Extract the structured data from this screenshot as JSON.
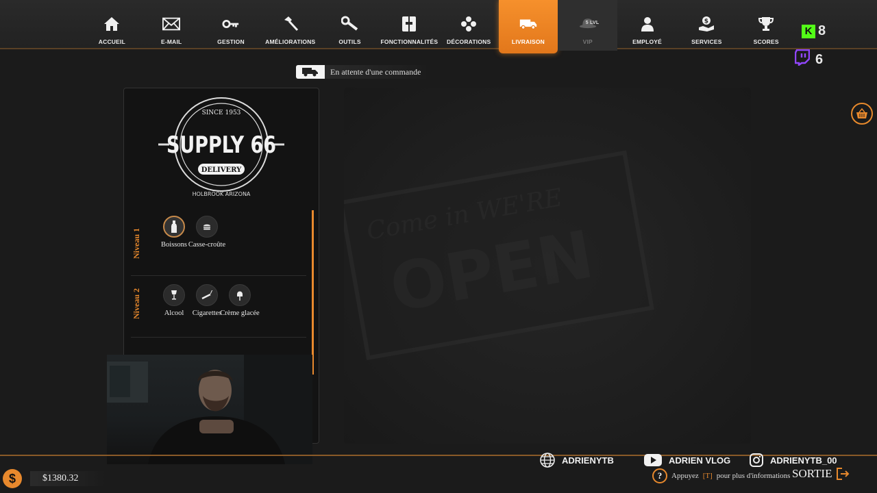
{
  "nav": {
    "items": [
      {
        "label": "ACCUEIL",
        "icon": "home-icon"
      },
      {
        "label": "E-MAIL",
        "icon": "mail-icon"
      },
      {
        "label": "GESTION",
        "icon": "key-icon"
      },
      {
        "label": "AMÉLIORATIONS",
        "icon": "hammer-icon"
      },
      {
        "label": "OUTILS",
        "icon": "wrench-icon"
      },
      {
        "label": "FONCTIONNALITÉS",
        "icon": "features-icon"
      },
      {
        "label": "DÉCORATIONS",
        "icon": "flower-icon"
      },
      {
        "label": "LIVRAISON",
        "icon": "truck-icon",
        "active": true
      },
      {
        "label": "VIP",
        "icon": "hat-icon",
        "badge": "5 LVL",
        "disabled": true
      },
      {
        "label": "EMPLOYÉ",
        "icon": "employee-icon"
      },
      {
        "label": "SERVICES",
        "icon": "services-icon"
      },
      {
        "label": "SCORES",
        "icon": "trophy-icon"
      }
    ]
  },
  "stream": {
    "kick_letter": "K",
    "kick_count": "8",
    "twitch_count": "6"
  },
  "status": {
    "text": "En attente d'une commande"
  },
  "logo": {
    "since": "SINCE 1953",
    "name": "SUPPLY 66",
    "tag": "DELIVERY",
    "location": "HOLBROOK ARIZONA"
  },
  "levels": [
    {
      "label": "Niveau 1",
      "products": [
        {
          "name": "Boissons",
          "icon": "bottle-icon",
          "selected": true
        },
        {
          "name": "Casse-croûte",
          "icon": "burger-icon"
        }
      ]
    },
    {
      "label": "Niveau 2",
      "products": [
        {
          "name": "Alcool",
          "icon": "wine-glass-icon"
        },
        {
          "name": "Cigarettes",
          "icon": "cigarette-icon"
        },
        {
          "name": "Crème glacée",
          "icon": "ice-cream-icon"
        }
      ]
    }
  ],
  "sign": {
    "line1": "Come in WE'RE",
    "line2": "OPEN"
  },
  "footer": {
    "currency_symbol": "$",
    "money": "$1380.32",
    "website": "ADRIENYTB",
    "youtube": "ADRIEN VLOG",
    "instagram": "ADRIENYTB_00",
    "help_prefix": "Appuyez",
    "help_key": "[T]",
    "help_suffix": "pour plus d'informations",
    "help_q": "?",
    "exit": "SORTIE"
  },
  "colors": {
    "accent": "#e8892d",
    "kick": "#53fc18",
    "twitch": "#9146ff",
    "youtube": "#ffffff"
  }
}
